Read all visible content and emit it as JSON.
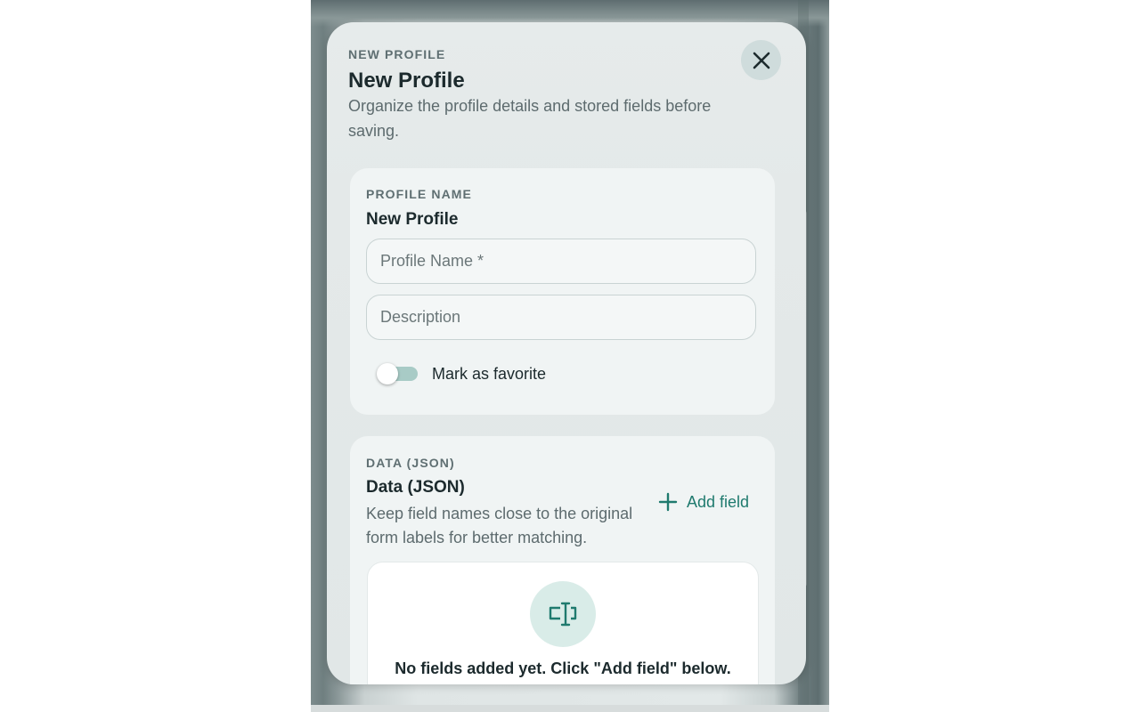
{
  "colors": {
    "accent": "#1f7a6e",
    "toggle_track": "#a8cbc6",
    "icon_bg": "#d9ece8"
  },
  "header": {
    "eyebrow": "NEW PROFILE",
    "title": "New Profile",
    "subtitle": "Organize the profile details and stored fields before saving.",
    "close_icon": "close-icon"
  },
  "profile_card": {
    "eyebrow": "PROFILE NAME",
    "title": "New Profile",
    "name_field": {
      "value": "",
      "placeholder": "Profile Name *"
    },
    "description_field": {
      "value": "",
      "placeholder": "Description"
    },
    "favorite_toggle": {
      "label": "Mark as favorite",
      "checked": false
    }
  },
  "data_card": {
    "eyebrow": "DATA (JSON)",
    "title": "Data (JSON)",
    "description": "Keep field names close to the original form labels for better matching.",
    "add_field_label": "Add field",
    "add_field_icon": "plus-icon",
    "empty_icon": "text-cursor-icon",
    "empty_text": "No fields added yet. Click \"Add field\" below."
  }
}
